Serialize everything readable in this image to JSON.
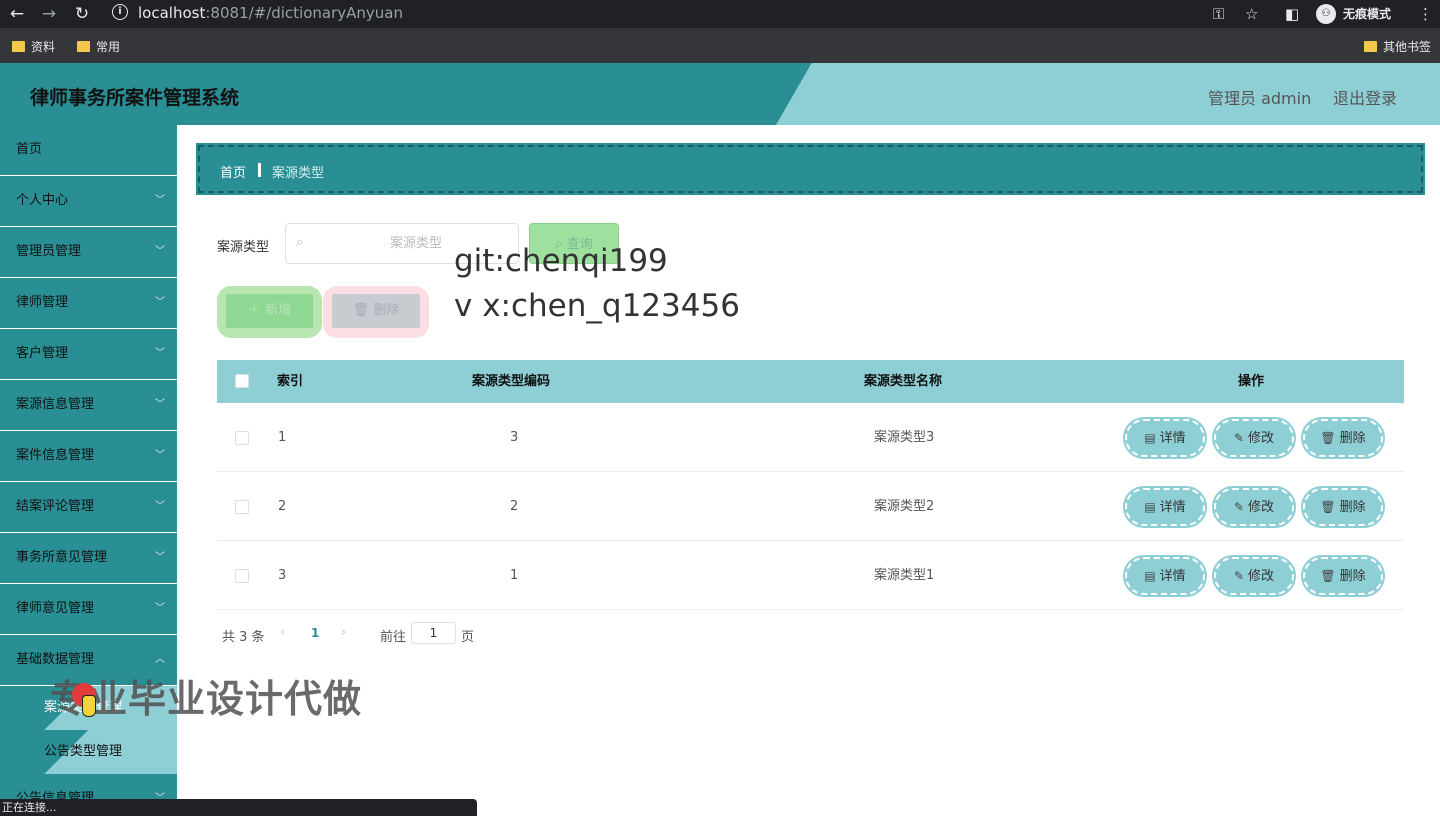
{
  "browser": {
    "url_host": "localhost",
    "url_rest": ":8081/#/dictionaryAnyuan",
    "incognito_label": "无痕模式",
    "bookmarks": [
      "资料",
      "常用"
    ],
    "other_bookmarks": "其他书签",
    "status_text": "正在连接..."
  },
  "header": {
    "title": "律师事务所案件管理系统",
    "user": "管理员 admin",
    "logout": "退出登录"
  },
  "sidebar": {
    "items": [
      {
        "label": "首页",
        "has_chevron": false
      },
      {
        "label": "个人中心",
        "has_chevron": true
      },
      {
        "label": "管理员管理",
        "has_chevron": true
      },
      {
        "label": "律师管理",
        "has_chevron": true
      },
      {
        "label": "客户管理",
        "has_chevron": true
      },
      {
        "label": "案源信息管理",
        "has_chevron": true
      },
      {
        "label": "案件信息管理",
        "has_chevron": true
      },
      {
        "label": "结案评论管理",
        "has_chevron": true
      },
      {
        "label": "事务所意见管理",
        "has_chevron": true
      },
      {
        "label": "律师意见管理",
        "has_chevron": true
      },
      {
        "label": "基础数据管理",
        "has_chevron": true
      }
    ],
    "subitems": [
      "案源类型管理",
      "公告类型管理"
    ],
    "last_item": "公告信息管理"
  },
  "breadcrumb": {
    "home": "首页",
    "current": "案源类型"
  },
  "search": {
    "label": "案源类型",
    "placeholder": "案源类型",
    "button": "查询"
  },
  "actions": {
    "add": "新增",
    "delete": "删除"
  },
  "watermarks": {
    "git": "git:chenqi199",
    "vx": "v x:chen_q123456",
    "pro": "专业毕业设计代做"
  },
  "table": {
    "columns": [
      "索引",
      "案源类型编码",
      "案源类型名称",
      "操作"
    ],
    "rows": [
      {
        "index": "1",
        "code": "3",
        "name": "案源类型3"
      },
      {
        "index": "2",
        "code": "2",
        "name": "案源类型2"
      },
      {
        "index": "3",
        "code": "1",
        "name": "案源类型1"
      }
    ],
    "row_actions": {
      "detail": "详情",
      "edit": "修改",
      "delete": "删除"
    }
  },
  "pagination": {
    "total": "共 3 条",
    "current_page": "1",
    "goto_label": "前往",
    "goto_value": "1",
    "page_suffix": "页"
  },
  "colors": {
    "primary": "#2a8f94",
    "light": "#8ecfd6"
  }
}
